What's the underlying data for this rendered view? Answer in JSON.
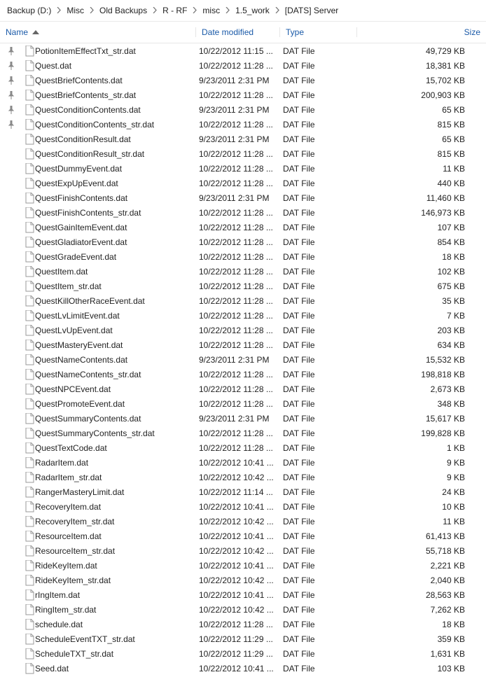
{
  "breadcrumb": [
    "Backup (D:)",
    "Misc",
    "Old Backups",
    "R - RF",
    "misc",
    "1.5_work",
    "[DATS] Server"
  ],
  "columns": {
    "name": "Name",
    "date": "Date modified",
    "type": "Type",
    "size": "Size"
  },
  "files": [
    {
      "pinned": true,
      "name": "PotionItemEffectTxt_str.dat",
      "date": "10/22/2012 11:15 ...",
      "type": "DAT File",
      "size": "49,729 KB"
    },
    {
      "pinned": true,
      "name": "Quest.dat",
      "date": "10/22/2012 11:28 ...",
      "type": "DAT File",
      "size": "18,381 KB"
    },
    {
      "pinned": true,
      "name": "QuestBriefContents.dat",
      "date": "9/23/2011 2:31 PM",
      "type": "DAT File",
      "size": "15,702 KB"
    },
    {
      "pinned": true,
      "name": "QuestBriefContents_str.dat",
      "date": "10/22/2012 11:28 ...",
      "type": "DAT File",
      "size": "200,903 KB"
    },
    {
      "pinned": true,
      "name": "QuestConditionContents.dat",
      "date": "9/23/2011 2:31 PM",
      "type": "DAT File",
      "size": "65 KB"
    },
    {
      "pinned": true,
      "name": "QuestConditionContents_str.dat",
      "date": "10/22/2012 11:28 ...",
      "type": "DAT File",
      "size": "815 KB"
    },
    {
      "pinned": false,
      "name": "QuestConditionResult.dat",
      "date": "9/23/2011 2:31 PM",
      "type": "DAT File",
      "size": "65 KB"
    },
    {
      "pinned": false,
      "name": "QuestConditionResult_str.dat",
      "date": "10/22/2012 11:28 ...",
      "type": "DAT File",
      "size": "815 KB"
    },
    {
      "pinned": false,
      "name": "QuestDummyEvent.dat",
      "date": "10/22/2012 11:28 ...",
      "type": "DAT File",
      "size": "11 KB"
    },
    {
      "pinned": false,
      "name": "QuestExpUpEvent.dat",
      "date": "10/22/2012 11:28 ...",
      "type": "DAT File",
      "size": "440 KB"
    },
    {
      "pinned": false,
      "name": "QuestFinishContents.dat",
      "date": "9/23/2011 2:31 PM",
      "type": "DAT File",
      "size": "11,460 KB"
    },
    {
      "pinned": false,
      "name": "QuestFinishContents_str.dat",
      "date": "10/22/2012 11:28 ...",
      "type": "DAT File",
      "size": "146,973 KB"
    },
    {
      "pinned": false,
      "name": "QuestGainItemEvent.dat",
      "date": "10/22/2012 11:28 ...",
      "type": "DAT File",
      "size": "107 KB"
    },
    {
      "pinned": false,
      "name": "QuestGladiatorEvent.dat",
      "date": "10/22/2012 11:28 ...",
      "type": "DAT File",
      "size": "854 KB"
    },
    {
      "pinned": false,
      "name": "QuestGradeEvent.dat",
      "date": "10/22/2012 11:28 ...",
      "type": "DAT File",
      "size": "18 KB"
    },
    {
      "pinned": false,
      "name": "QuestItem.dat",
      "date": "10/22/2012 11:28 ...",
      "type": "DAT File",
      "size": "102 KB"
    },
    {
      "pinned": false,
      "name": "QuestItem_str.dat",
      "date": "10/22/2012 11:28 ...",
      "type": "DAT File",
      "size": "675 KB"
    },
    {
      "pinned": false,
      "name": "QuestKillOtherRaceEvent.dat",
      "date": "10/22/2012 11:28 ...",
      "type": "DAT File",
      "size": "35 KB"
    },
    {
      "pinned": false,
      "name": "QuestLvLimitEvent.dat",
      "date": "10/22/2012 11:28 ...",
      "type": "DAT File",
      "size": "7 KB"
    },
    {
      "pinned": false,
      "name": "QuestLvUpEvent.dat",
      "date": "10/22/2012 11:28 ...",
      "type": "DAT File",
      "size": "203 KB"
    },
    {
      "pinned": false,
      "name": "QuestMasteryEvent.dat",
      "date": "10/22/2012 11:28 ...",
      "type": "DAT File",
      "size": "634 KB"
    },
    {
      "pinned": false,
      "name": "QuestNameContents.dat",
      "date": "9/23/2011 2:31 PM",
      "type": "DAT File",
      "size": "15,532 KB"
    },
    {
      "pinned": false,
      "name": "QuestNameContents_str.dat",
      "date": "10/22/2012 11:28 ...",
      "type": "DAT File",
      "size": "198,818 KB"
    },
    {
      "pinned": false,
      "name": "QuestNPCEvent.dat",
      "date": "10/22/2012 11:28 ...",
      "type": "DAT File",
      "size": "2,673 KB"
    },
    {
      "pinned": false,
      "name": "QuestPromoteEvent.dat",
      "date": "10/22/2012 11:28 ...",
      "type": "DAT File",
      "size": "348 KB"
    },
    {
      "pinned": false,
      "name": "QuestSummaryContents.dat",
      "date": "9/23/2011 2:31 PM",
      "type": "DAT File",
      "size": "15,617 KB"
    },
    {
      "pinned": false,
      "name": "QuestSummaryContents_str.dat",
      "date": "10/22/2012 11:28 ...",
      "type": "DAT File",
      "size": "199,828 KB"
    },
    {
      "pinned": false,
      "name": "QuestTextCode.dat",
      "date": "10/22/2012 11:28 ...",
      "type": "DAT File",
      "size": "1 KB"
    },
    {
      "pinned": false,
      "name": "RadarItem.dat",
      "date": "10/22/2012 10:41 ...",
      "type": "DAT File",
      "size": "9 KB"
    },
    {
      "pinned": false,
      "name": "RadarItem_str.dat",
      "date": "10/22/2012 10:42 ...",
      "type": "DAT File",
      "size": "9 KB"
    },
    {
      "pinned": false,
      "name": "RangerMasteryLimit.dat",
      "date": "10/22/2012 11:14 ...",
      "type": "DAT File",
      "size": "24 KB"
    },
    {
      "pinned": false,
      "name": "RecoveryItem.dat",
      "date": "10/22/2012 10:41 ...",
      "type": "DAT File",
      "size": "10 KB"
    },
    {
      "pinned": false,
      "name": "RecoveryItem_str.dat",
      "date": "10/22/2012 10:42 ...",
      "type": "DAT File",
      "size": "11 KB"
    },
    {
      "pinned": false,
      "name": "ResourceItem.dat",
      "date": "10/22/2012 10:41 ...",
      "type": "DAT File",
      "size": "61,413 KB"
    },
    {
      "pinned": false,
      "name": "ResourceItem_str.dat",
      "date": "10/22/2012 10:42 ...",
      "type": "DAT File",
      "size": "55,718 KB"
    },
    {
      "pinned": false,
      "name": "RideKeyItem.dat",
      "date": "10/22/2012 10:41 ...",
      "type": "DAT File",
      "size": "2,221 KB"
    },
    {
      "pinned": false,
      "name": "RideKeyItem_str.dat",
      "date": "10/22/2012 10:42 ...",
      "type": "DAT File",
      "size": "2,040 KB"
    },
    {
      "pinned": false,
      "name": "rIngItem.dat",
      "date": "10/22/2012 10:41 ...",
      "type": "DAT File",
      "size": "28,563 KB"
    },
    {
      "pinned": false,
      "name": "RingItem_str.dat",
      "date": "10/22/2012 10:42 ...",
      "type": "DAT File",
      "size": "7,262 KB"
    },
    {
      "pinned": false,
      "name": "schedule.dat",
      "date": "10/22/2012 11:28 ...",
      "type": "DAT File",
      "size": "18 KB"
    },
    {
      "pinned": false,
      "name": "ScheduleEventTXT_str.dat",
      "date": "10/22/2012 11:29 ...",
      "type": "DAT File",
      "size": "359 KB"
    },
    {
      "pinned": false,
      "name": "ScheduleTXT_str.dat",
      "date": "10/22/2012 11:29 ...",
      "type": "DAT File",
      "size": "1,631 KB"
    },
    {
      "pinned": false,
      "name": "Seed.dat",
      "date": "10/22/2012 10:41 ...",
      "type": "DAT File",
      "size": "103 KB"
    }
  ]
}
